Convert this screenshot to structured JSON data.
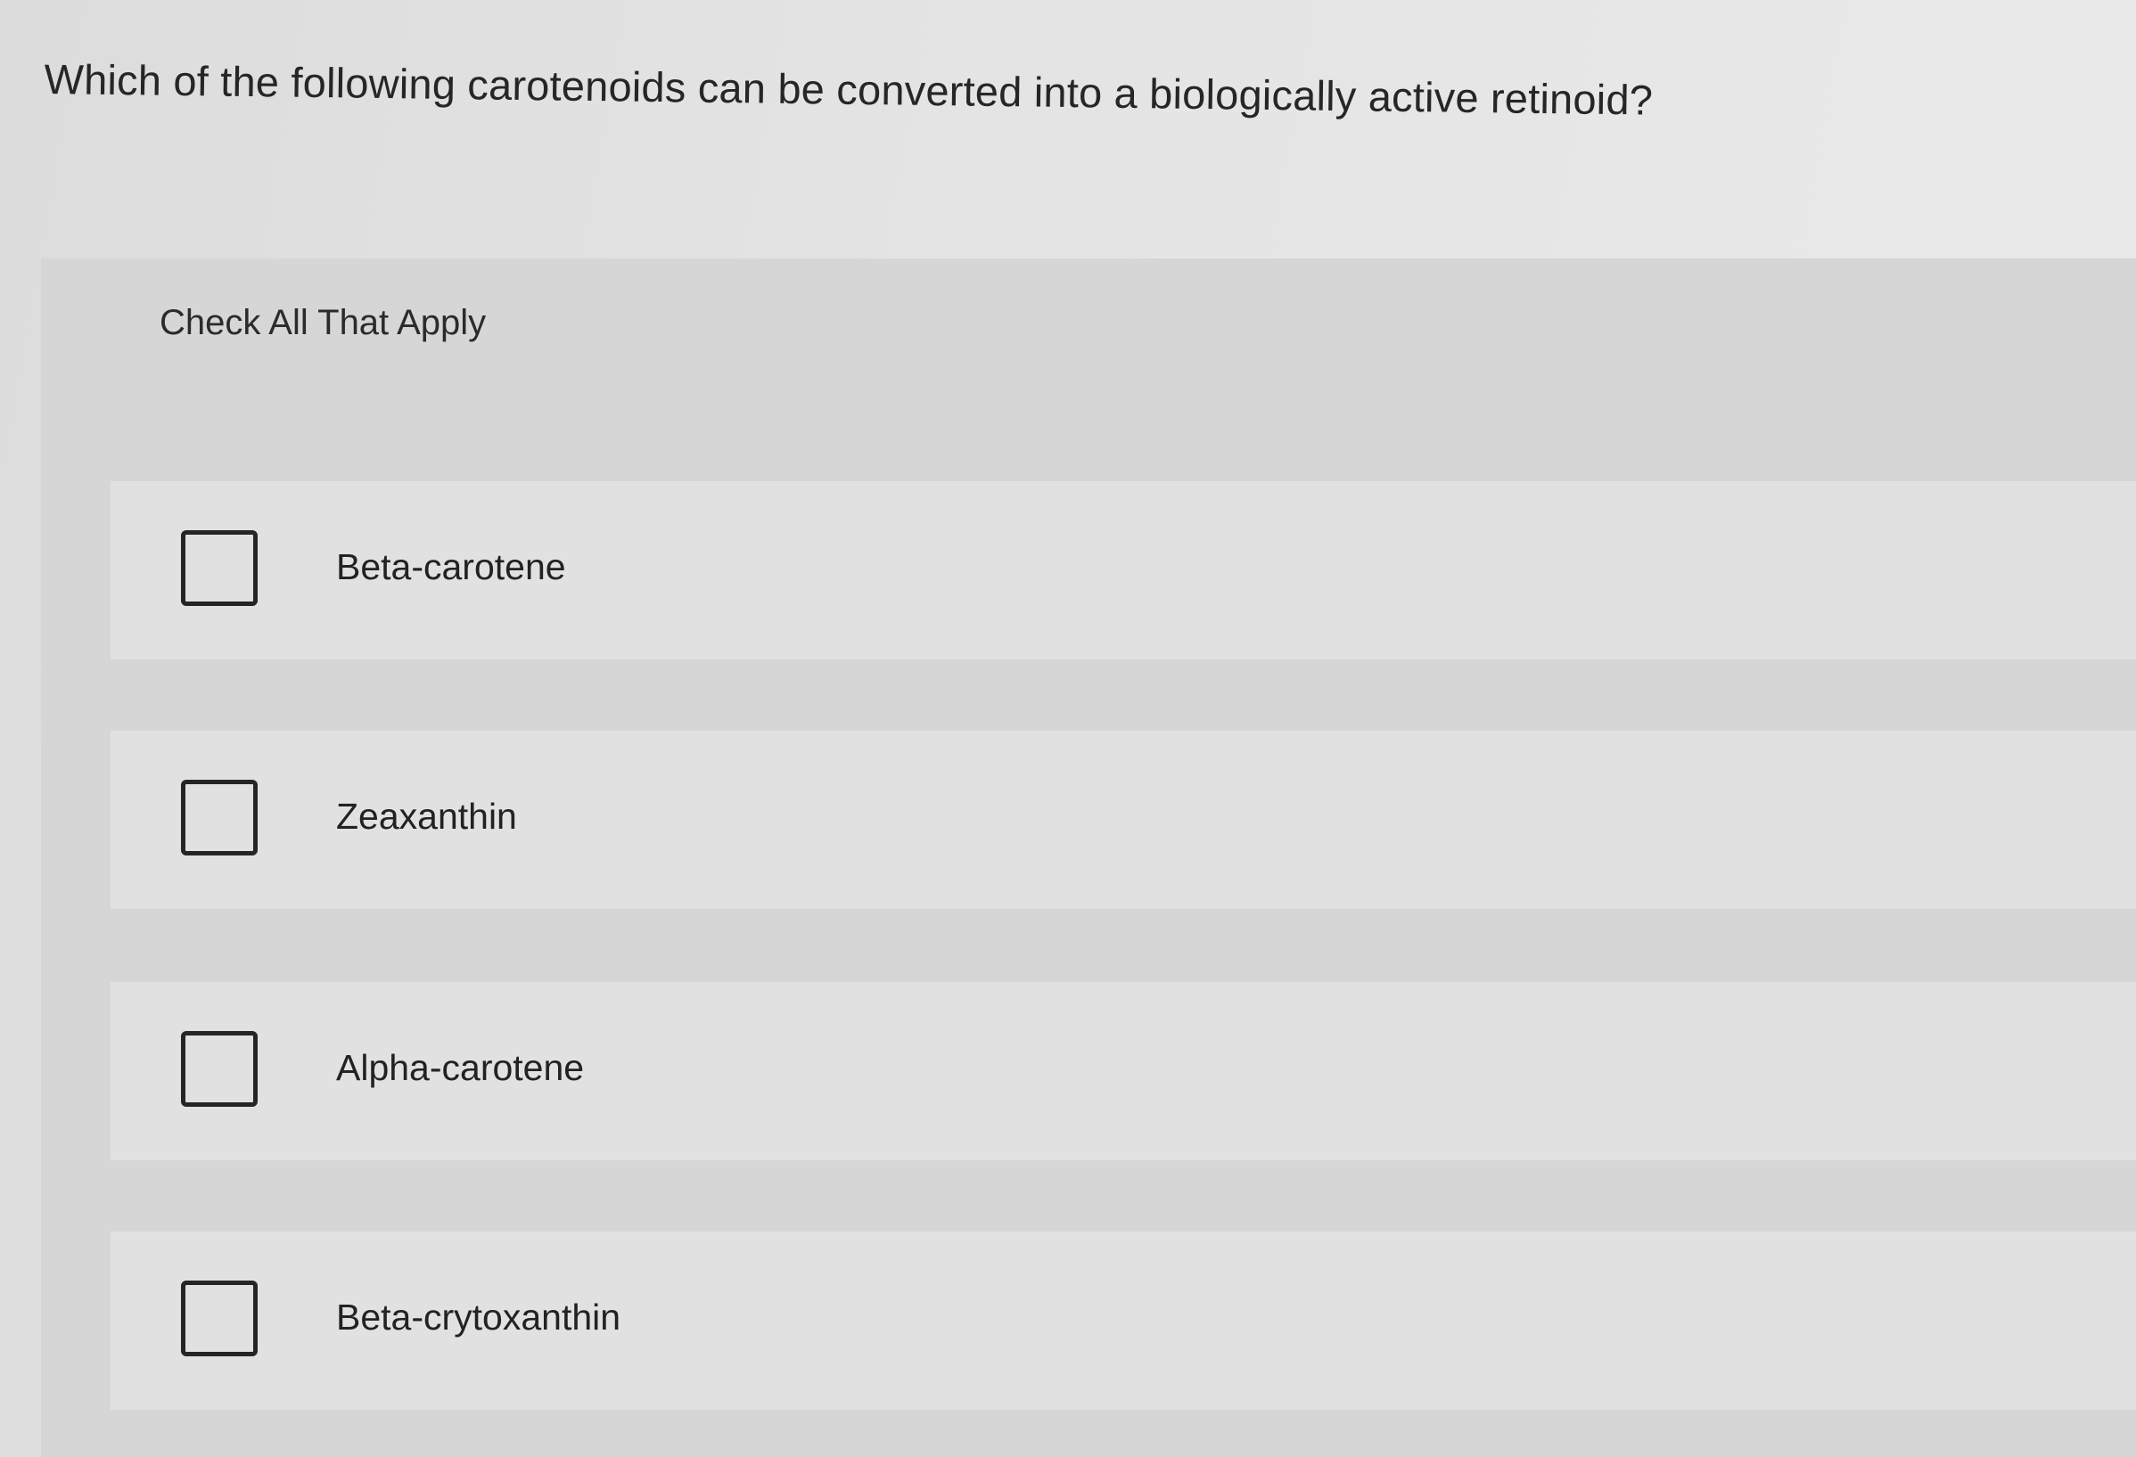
{
  "question": {
    "text": "Which of the following carotenoids can be converted into a biologically active retinoid?"
  },
  "instruction": {
    "text": "Check All That Apply"
  },
  "options": [
    {
      "label": "Beta-carotene",
      "checked": false
    },
    {
      "label": "Zeaxanthin",
      "checked": false
    },
    {
      "label": "Alpha-carotene",
      "checked": false
    },
    {
      "label": "Beta-crytoxanthin",
      "checked": false
    }
  ]
}
